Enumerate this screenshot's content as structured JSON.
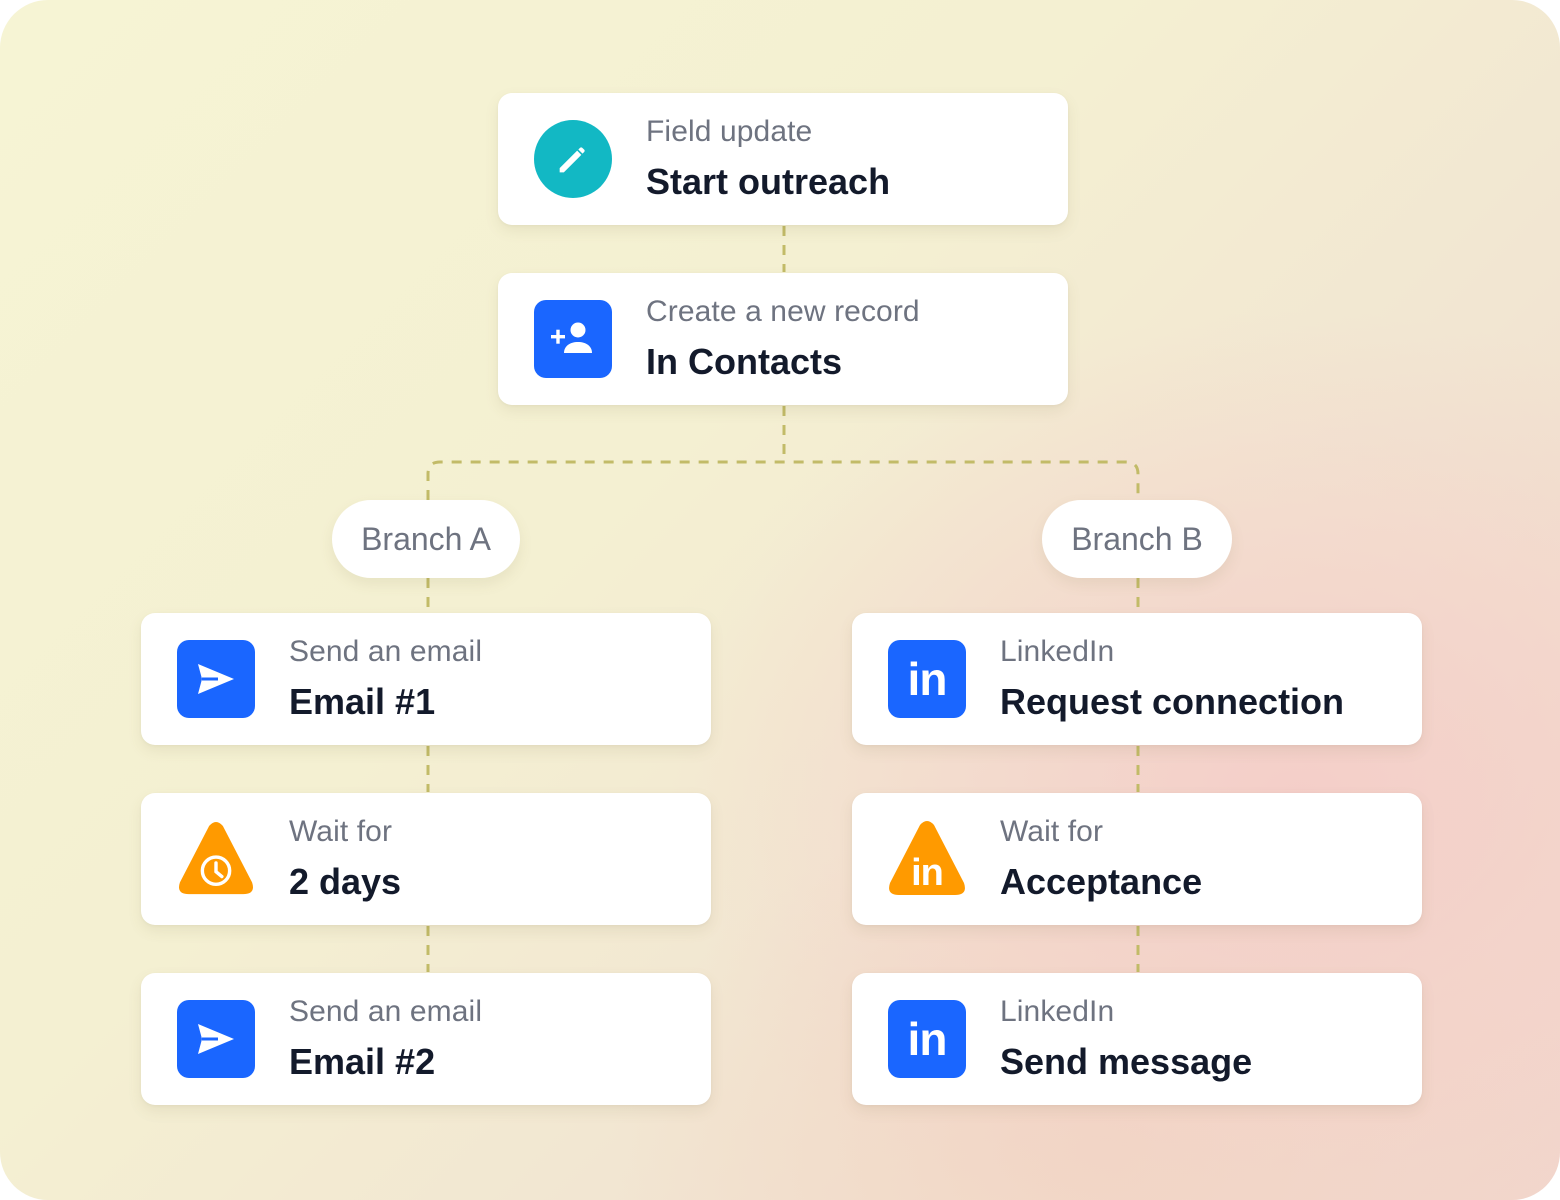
{
  "colors": {
    "teal": "#12b8c4",
    "blue": "#1a66ff",
    "orange": "#ff9a00",
    "connector": "#c2bb68",
    "subtitle_text": "#6e7380",
    "title_text": "#131a2b"
  },
  "nodes": {
    "field_update": {
      "subtitle": "Field update",
      "title": "Start outreach",
      "icon": "pencil-icon"
    },
    "create_record": {
      "subtitle": "Create a new record",
      "title": "In Contacts",
      "icon": "add-person-icon"
    }
  },
  "branches": {
    "a": {
      "label": "Branch A",
      "steps": [
        {
          "subtitle": "Send an email",
          "title": "Email #1",
          "icon": "send-icon"
        },
        {
          "subtitle": "Wait for",
          "title": "2 days",
          "icon": "clock-warning-icon"
        },
        {
          "subtitle": "Send an email",
          "title": "Email #2",
          "icon": "send-icon"
        }
      ]
    },
    "b": {
      "label": "Branch B",
      "steps": [
        {
          "subtitle": "LinkedIn",
          "title": "Request connection",
          "icon": "linkedin-icon"
        },
        {
          "subtitle": "Wait for",
          "title": "Acceptance",
          "icon": "linkedin-warning-icon"
        },
        {
          "subtitle": "LinkedIn",
          "title": "Send message",
          "icon": "linkedin-icon"
        }
      ]
    }
  },
  "icon_glyphs": {
    "linkedin": "in"
  }
}
